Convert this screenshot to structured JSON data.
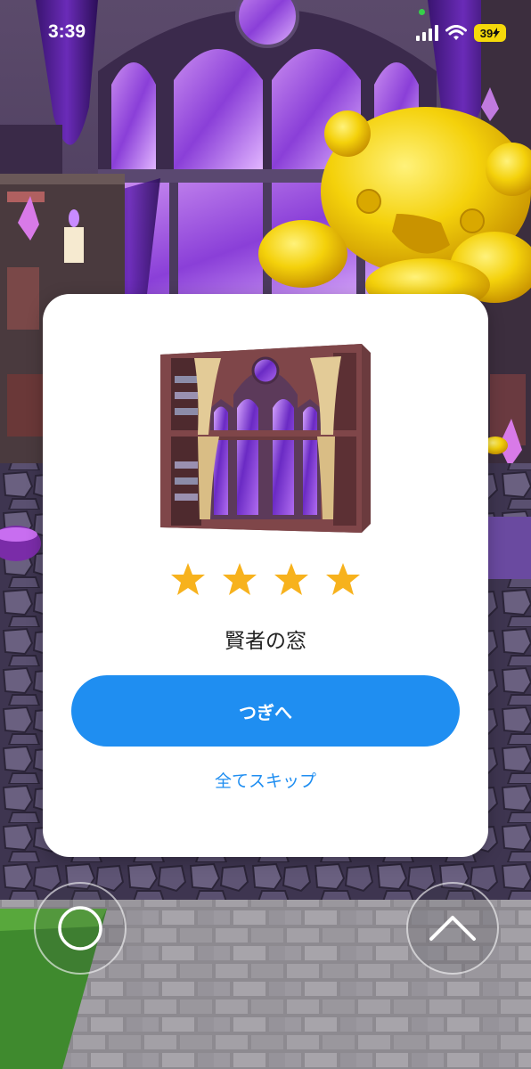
{
  "status_bar": {
    "time": "3:39",
    "battery": "39"
  },
  "dialog": {
    "item_name": "賢者の窓",
    "star_count": 4,
    "star_color": "#f7b21d",
    "next_label": "つぎへ",
    "skip_label": "全てスキップ"
  },
  "controls": {
    "left_icon": "circle-icon",
    "right_icon": "chevron-up-icon"
  },
  "colors": {
    "accent": "#1f8ef1",
    "battery": "#f5d90a"
  }
}
